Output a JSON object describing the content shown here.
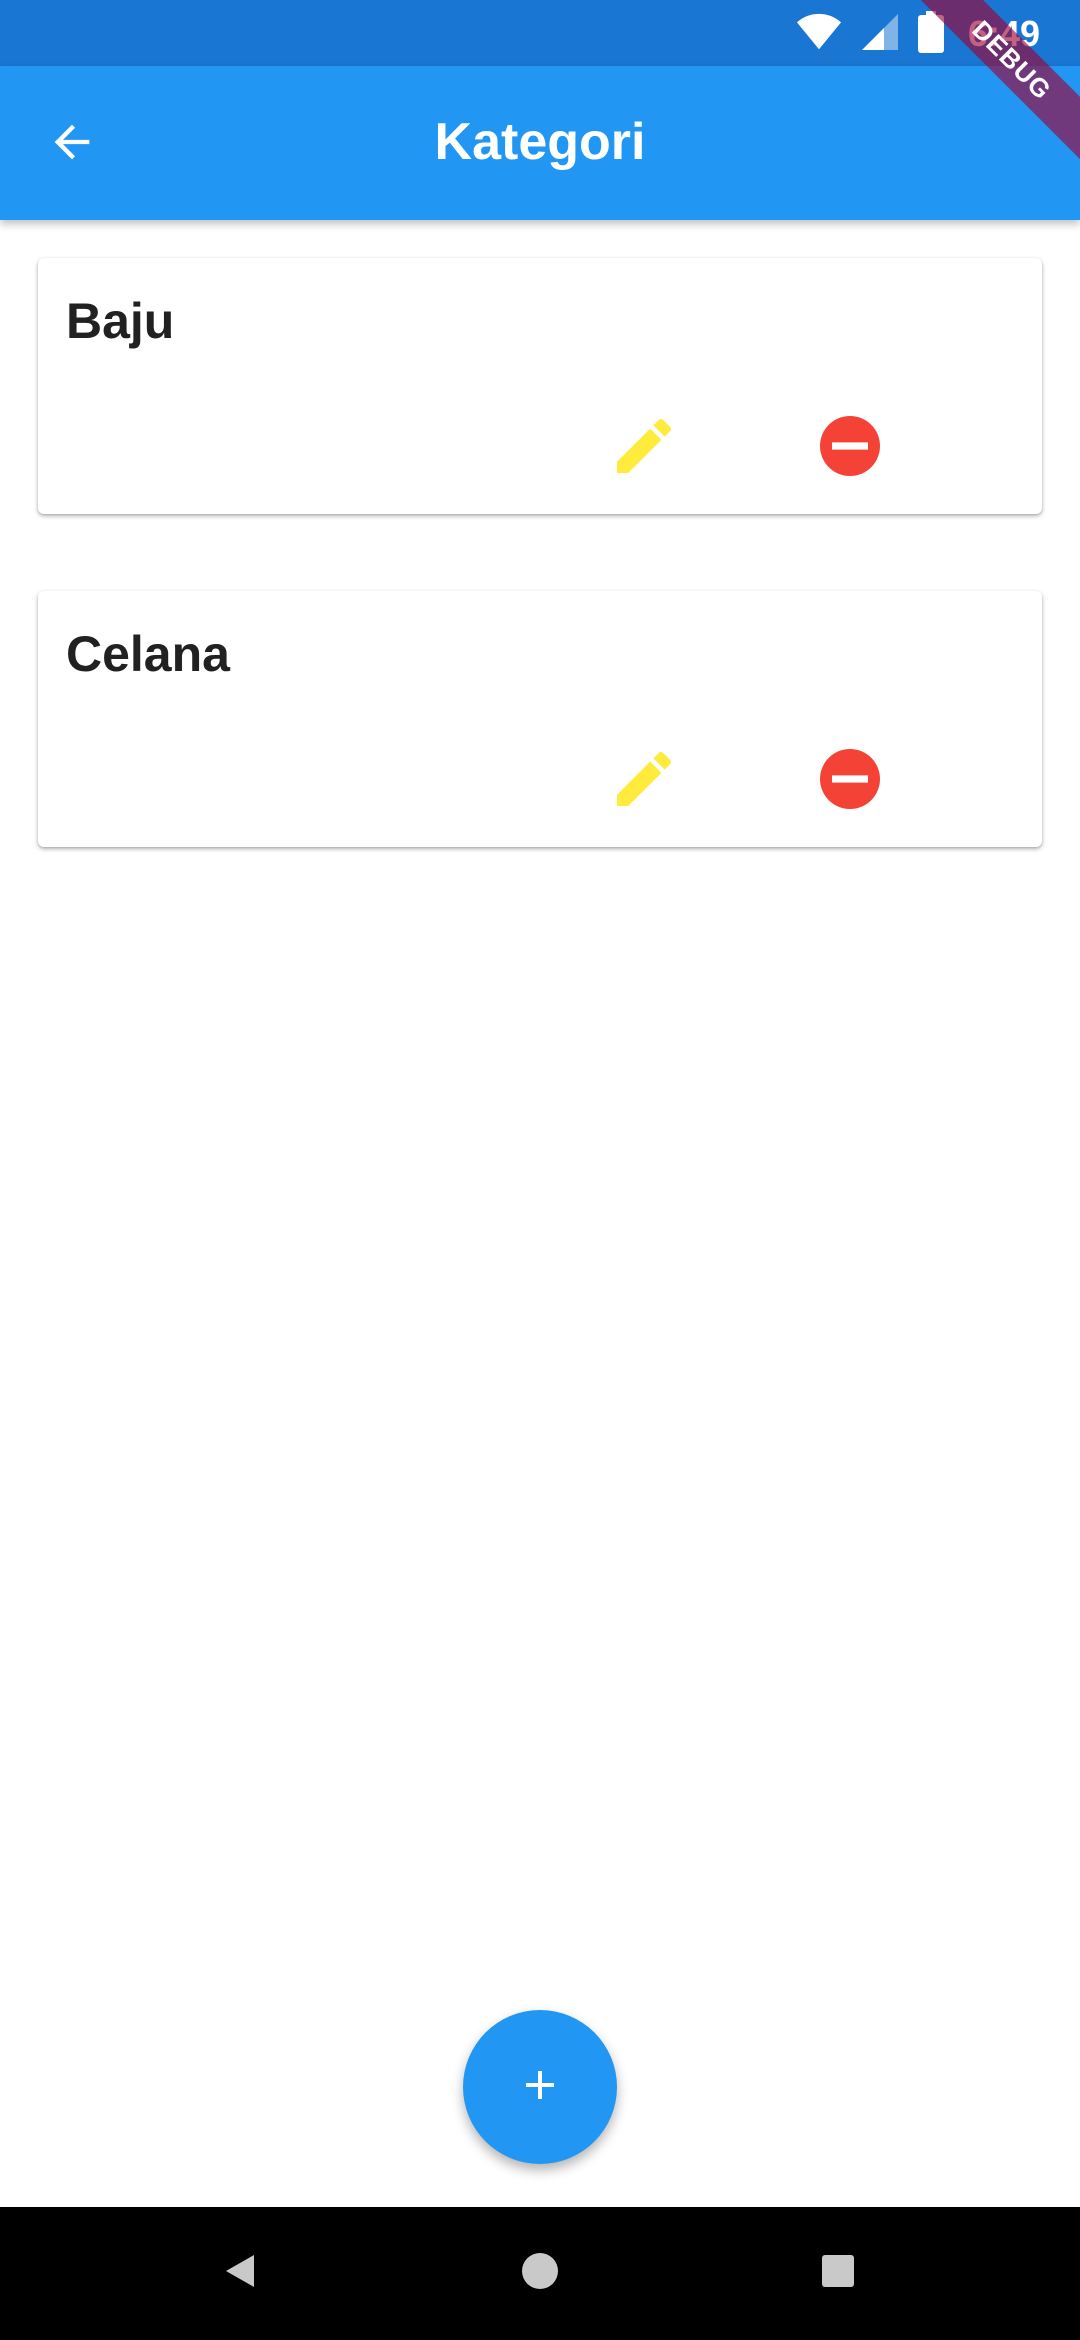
{
  "status_bar": {
    "time": "6:49",
    "icons": [
      "wifi-icon",
      "signal-icon",
      "battery-icon"
    ]
  },
  "debug_banner": {
    "label": "DEBUG"
  },
  "app_bar": {
    "title": "Kategori",
    "back_icon": "arrow-back-icon"
  },
  "categories": [
    {
      "name": "Baju"
    },
    {
      "name": "Celana"
    }
  ],
  "actions": {
    "edit_icon": "pencil-icon",
    "delete_icon": "minus-circle-icon"
  },
  "fab": {
    "icon": "plus-icon"
  },
  "nav_bar": {
    "icons": [
      "triangle-back-icon",
      "circle-home-icon",
      "square-recents-icon"
    ]
  },
  "colors": {
    "status_bar": "#1976d2",
    "app_bar": "#2196f3",
    "edit_icon": "#ffeb3b",
    "delete_icon": "#f44336",
    "fab": "#2196f3",
    "nav_bar": "#000000"
  }
}
